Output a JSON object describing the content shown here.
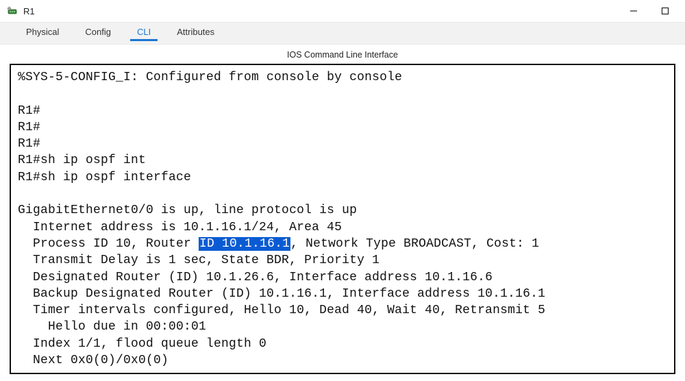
{
  "window": {
    "title": "R1"
  },
  "tabs": {
    "physical": "Physical",
    "config": "Config",
    "cli": "CLI",
    "attributes": "Attributes"
  },
  "section_label": "IOS Command Line Interface",
  "cli": {
    "l0": "%SYS-5-CONFIG_I: Configured from console by console",
    "l1": "",
    "l2": "R1#",
    "l3": "R1#",
    "l4": "R1#",
    "l5": "R1#sh ip ospf int",
    "l6": "R1#sh ip ospf interface",
    "l7": "",
    "l8": "GigabitEthernet0/0 is up, line protocol is up",
    "l9": "  Internet address is 10.1.16.1/24, Area 45",
    "l10a": "  Process ID 10, Router ",
    "l10_hl": "ID 10.1.16.1",
    "l10b": ", Network Type BROADCAST, Cost: 1",
    "l11": "  Transmit Delay is 1 sec, State BDR, Priority 1",
    "l12": "  Designated Router (ID) 10.1.26.6, Interface address 10.1.16.6",
    "l13": "  Backup Designated Router (ID) 10.1.16.1, Interface address 10.1.16.1",
    "l14": "  Timer intervals configured, Hello 10, Dead 40, Wait 40, Retransmit 5",
    "l15": "    Hello due in 00:00:01",
    "l16": "  Index 1/1, flood queue length 0",
    "l17": "  Next 0x0(0)/0x0(0)"
  }
}
